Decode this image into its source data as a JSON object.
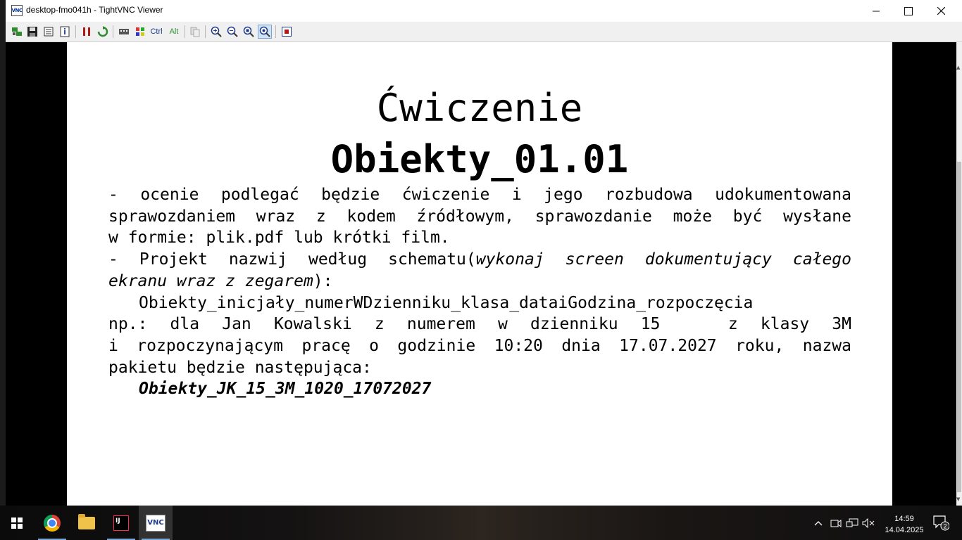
{
  "window": {
    "title": "desktop-fmo041h - TightVNC Viewer",
    "app_icon_text": "VNC"
  },
  "toolbar": {
    "ctrl_label": "Ctrl",
    "alt_label": "Alt"
  },
  "slide": {
    "heading": "Ćwiczenie",
    "subheading": "Obiekty_01.01",
    "lines": [
      "- ocenie podlegać będzie ćwiczenie i jego rozbudowa udokumentowana",
      "sprawozdaniem wraz z kodem źródłowym, sprawozdanie może być wysłane",
      "w formie: plik.pdf lub krótki film.",
      "- Projekt nazwij według schematu(",
      "wykonaj screen dokumentujący całego",
      "ekranu wraz z zegarem",
      "):",
      "Obiekty_inicjały_numerWDzienniku_klasa_dataiGodzina_rozpoczęcia",
      "np.: dla Jan Kowalski z numerem w dzienniku 15   z klasy 3M",
      "i rozpoczynającym pracę o godzinie 10:20 dnia 17.07.2027 roku, nazwa",
      "pakietu będzie następująca:",
      "Obiekty_JK_15_3M_1020_17072027"
    ]
  },
  "taskbar": {
    "time": "14:59",
    "date": "14.04.2025",
    "notification_count": "2",
    "intellij_label": "IJ",
    "vnc_label": "VNC"
  }
}
